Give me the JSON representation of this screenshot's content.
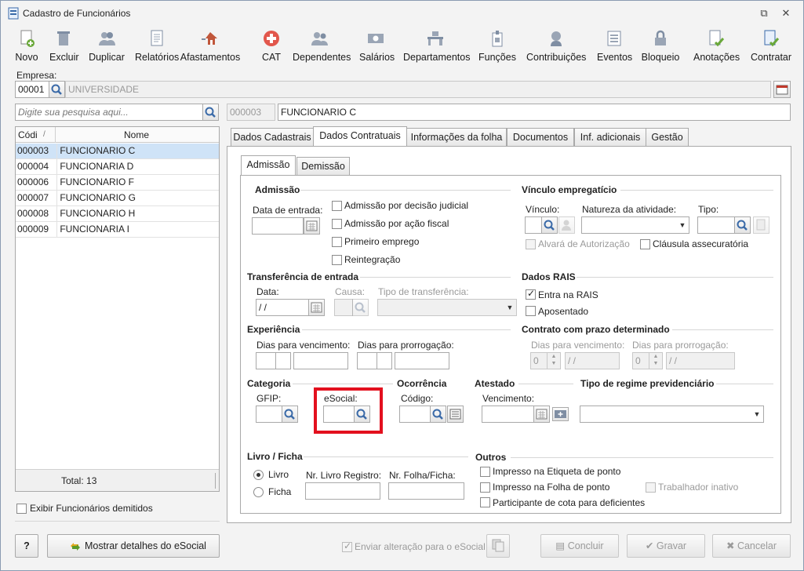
{
  "window": {
    "title": "Cadastro de Funcionários"
  },
  "toolbar": [
    {
      "label": "Novo",
      "icon": "new-document-icon"
    },
    {
      "label": "Excluir",
      "icon": "trash-icon"
    },
    {
      "label": "Duplicar",
      "icon": "users-icon"
    },
    {
      "label": "Relatórios",
      "icon": "report-icon"
    },
    {
      "label": "Afastamentos",
      "icon": "house-arrow-icon"
    },
    {
      "label": "CAT",
      "icon": "red-cross-icon"
    },
    {
      "label": "Dependentes",
      "icon": "people-icon"
    },
    {
      "label": "Salários",
      "icon": "money-icon"
    },
    {
      "label": "Departamentos",
      "icon": "desk-icon"
    },
    {
      "label": "Funções",
      "icon": "badge-icon"
    },
    {
      "label": "Contribuições",
      "icon": "person-head-icon"
    },
    {
      "label": "Eventos",
      "icon": "list-icon"
    },
    {
      "label": "Bloqueio",
      "icon": "lock-icon"
    },
    {
      "label": "Anotações",
      "icon": "note-check-icon"
    },
    {
      "label": "Contratar",
      "icon": "contract-check-icon"
    }
  ],
  "empresa": {
    "label": "Empresa:",
    "code": "00001",
    "name": "UNIVERSIDADE"
  },
  "search": {
    "placeholder": "Digite sua pesquisa aqui..."
  },
  "current": {
    "code": "000003",
    "name": "FUNCIONARIO C"
  },
  "grid": {
    "headers": [
      "Códi",
      "Nome"
    ],
    "rows": [
      {
        "code": "000003",
        "name": "FUNCIONARIO C"
      },
      {
        "code": "000004",
        "name": "FUNCIONARIA D"
      },
      {
        "code": "000006",
        "name": "FUNCIONARIO F"
      },
      {
        "code": "000007",
        "name": "FUNCIONARIO G"
      },
      {
        "code": "000008",
        "name": "FUNCIONARIO H"
      },
      {
        "code": "000009",
        "name": "FUNCIONARIA I"
      }
    ],
    "total": "Total: 13"
  },
  "show_dismissed": "Exibir Funcionários demitidos",
  "tabs": [
    "Dados Cadastrais",
    "Dados Contratuais",
    "Informações da folha",
    "Documentos",
    "Inf. adicionais",
    "Gestão"
  ],
  "subtabs": [
    "Admissão",
    "Demissão"
  ],
  "admissao": {
    "title": "Admissão",
    "date_label": "Data de entrada:",
    "checks": [
      "Admissão por decisão judicial",
      "Admissão por ação fiscal",
      "Primeiro emprego",
      "Reintegração"
    ]
  },
  "vinculo": {
    "title": "Vínculo empregatício",
    "vinculo_label": "Vínculo:",
    "natureza_label": "Natureza da atividade:",
    "tipo_label": "Tipo:",
    "alvara": "Alvará de Autorização",
    "clausula": "Cláusula assecuratória"
  },
  "transferencia": {
    "title": "Transferência de entrada",
    "data_label": "Data:",
    "data_value": " / /",
    "causa_label": "Causa:",
    "tipo_label": "Tipo de transferência:"
  },
  "rais": {
    "title": "Dados RAIS",
    "entra": "Entra na RAIS",
    "aposentado": "Aposentado"
  },
  "experiencia": {
    "title": "Experiência",
    "venc_label": "Dias para vencimento:",
    "prorr_label": "Dias para prorrogação:"
  },
  "contrato": {
    "title": "Contrato com prazo determinado",
    "venc_label": "Dias para vencimento:",
    "prorr_label": "Dias para prorrogação:",
    "venc_num": "0",
    "venc_date": "/ /",
    "prorr_num": "0",
    "prorr_date": "/ /"
  },
  "categoria": {
    "title": "Categoria",
    "gfip_label": "GFIP:",
    "esocial_label": "eSocial:"
  },
  "ocorrencia": {
    "title": "Ocorrência",
    "codigo_label": "Código:"
  },
  "atestado": {
    "title": "Atestado",
    "venc_label": "Vencimento:"
  },
  "regime": {
    "title": "Tipo de regime previdenciário"
  },
  "livro": {
    "title": "Livro / Ficha",
    "livro": "Livro",
    "ficha": "Ficha",
    "reg_label": "Nr. Livro Registro:",
    "folha_label": "Nr. Folha/Ficha:"
  },
  "outros": {
    "title": "Outros",
    "etiqueta": "Impresso na Etiqueta de ponto",
    "folha": "Impresso na Folha de ponto",
    "inativo": "Trabalhador inativo",
    "cota": "Participante de cota para deficientes"
  },
  "footer": {
    "help": "?",
    "esocial_details": "Mostrar detalhes do eSocial",
    "enviar": "Enviar alteração para o eSocial",
    "concluir": "Concluir",
    "gravar": "Gravar",
    "cancelar": "Cancelar"
  },
  "colors": {
    "highlight": "#e3101e",
    "selection": "#cfe3f7",
    "accent_check": "#4a9a2a"
  }
}
